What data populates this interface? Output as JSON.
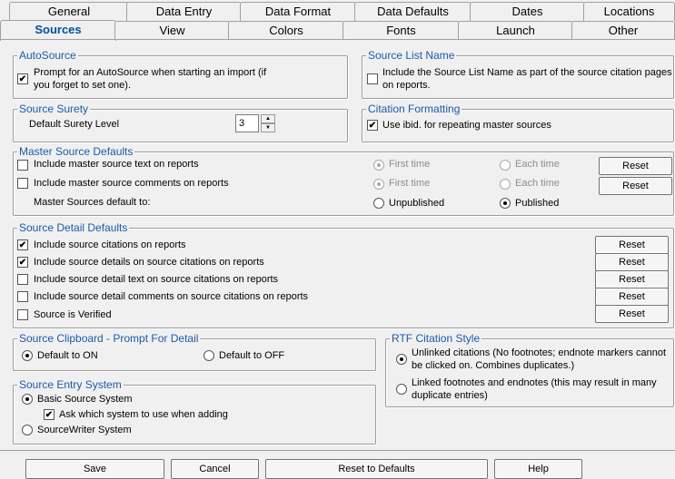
{
  "tabs_row1": [
    "General",
    "Data Entry",
    "Data Format",
    "Data Defaults",
    "Dates",
    "Locations"
  ],
  "tabs_row2": [
    "Sources",
    "View",
    "Colors",
    "Fonts",
    "Launch",
    "Other"
  ],
  "active_tab": "Sources",
  "autosource": {
    "title": "AutoSource",
    "prompt_label_line1": "Prompt for an AutoSource when starting an import (if",
    "prompt_label_line2": "you forget to set one).",
    "prompt_checked": true
  },
  "source_list_name": {
    "title": "Source List Name",
    "include_label_line1": "Include the Source List Name as part of the source citation pages",
    "include_label_line2": "on reports.",
    "include_checked": false
  },
  "source_surety": {
    "title": "Source Surety",
    "default_label": "Default Surety Level",
    "default_value": "3"
  },
  "citation_formatting": {
    "title": "Citation Formatting",
    "ibid_label": "Use ibid. for repeating master sources",
    "ibid_checked": true
  },
  "master_source_defaults": {
    "title": "Master Source Defaults",
    "text_label": "Include master source text on reports",
    "comments_label": "Include master source comments on reports",
    "default_to_label": "Master Sources default to:",
    "first_time": "First time",
    "each_time": "Each time",
    "unpublished": "Unpublished",
    "published": "Published",
    "reset": "Reset"
  },
  "source_detail_defaults": {
    "title": "Source Detail Defaults",
    "items": [
      {
        "label": "Include source citations on reports",
        "checked": true
      },
      {
        "label": "Include source details on source citations on reports",
        "checked": true
      },
      {
        "label": "Include source detail text on source citations on reports",
        "checked": false
      },
      {
        "label": "Include source detail comments on source citations on reports",
        "checked": false
      },
      {
        "label": "Source is Verified",
        "checked": false
      }
    ],
    "reset": "Reset"
  },
  "clipboard": {
    "title": "Source Clipboard - Prompt For Detail",
    "on_label": "Default to ON",
    "off_label": "Default to OFF"
  },
  "rtf": {
    "title": "RTF Citation Style",
    "unlinked_line1": "Unlinked citations (No footnotes; endnote markers cannot",
    "unlinked_line2": "be clicked on.  Combines duplicates.)",
    "linked_line1": "Linked footnotes and endnotes (this may result in many",
    "linked_line2": "duplicate entries)"
  },
  "entry_system": {
    "title": "Source Entry System",
    "basic_label": "Basic Source System",
    "ask_label": "Ask which system to use when adding",
    "sourcewriter_label": "SourceWriter System"
  },
  "footer": {
    "save": "Save",
    "cancel": "Cancel",
    "reset_defaults": "Reset to Defaults",
    "help": "Help"
  }
}
